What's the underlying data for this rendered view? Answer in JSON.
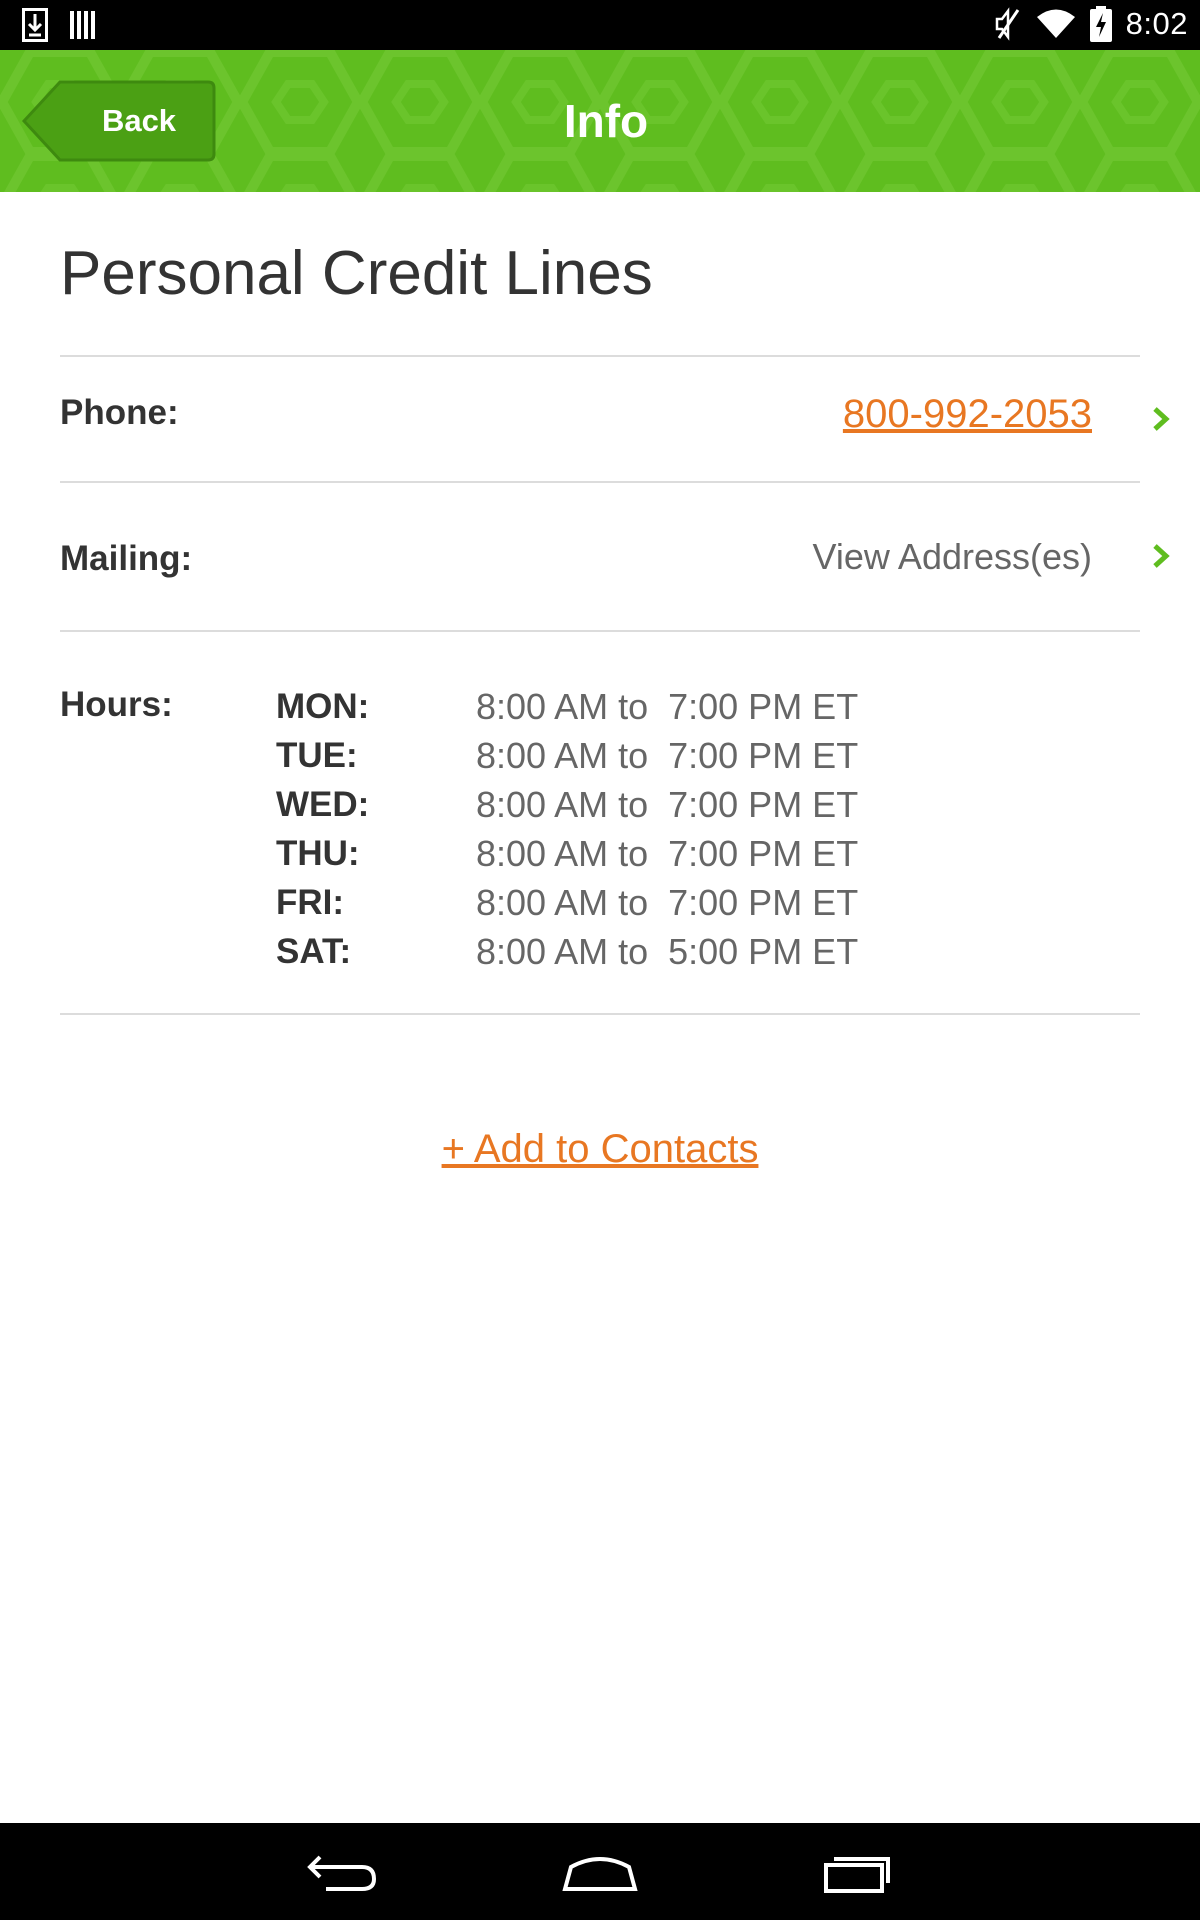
{
  "status_bar": {
    "time": "8:02",
    "icons": [
      "download-icon",
      "barcode-icon",
      "mute-icon",
      "wifi-icon",
      "battery-charging-icon"
    ]
  },
  "header": {
    "back_label": "Back",
    "title": "Info",
    "color": "#5fbd1f"
  },
  "page": {
    "title": "Personal Credit Lines",
    "phone_label": "Phone:",
    "phone_value": "800-992-2053",
    "mailing_label": "Mailing:",
    "mailing_value": "View Address(es)",
    "hours_label": "Hours:",
    "hours": [
      {
        "day": "MON:",
        "time": "8:00 AM to  7:00 PM ET"
      },
      {
        "day": "TUE:",
        "time": "8:00 AM to  7:00 PM ET"
      },
      {
        "day": "WED:",
        "time": "8:00 AM to  7:00 PM ET"
      },
      {
        "day": "THU:",
        "time": "8:00 AM to  7:00 PM ET"
      },
      {
        "day": "FRI:",
        "time": "8:00 AM to  7:00 PM ET"
      },
      {
        "day": "SAT:",
        "time": "8:00 AM to  5:00 PM ET"
      }
    ],
    "add_contacts": "+ Add to Contacts",
    "link_color": "#e87722"
  },
  "nav_bar": {
    "icons": [
      "back-nav-icon",
      "home-nav-icon",
      "recents-nav-icon"
    ]
  }
}
